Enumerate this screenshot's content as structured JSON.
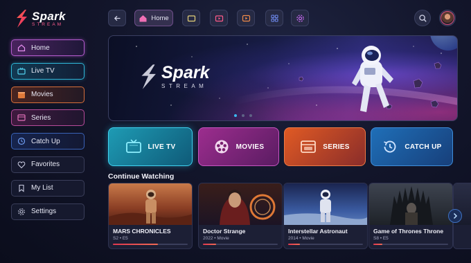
{
  "brand": {
    "name": "Spark",
    "sub": "STREAM"
  },
  "sidebar": {
    "items": [
      {
        "label": "Home",
        "icon": "home-icon",
        "color": "#c65cd9"
      },
      {
        "label": "Live TV",
        "icon": "tv-icon",
        "color": "#2fb8d9"
      },
      {
        "label": "Movies",
        "icon": "clapperboard-icon",
        "color": "#e07a3a"
      },
      {
        "label": "Series",
        "icon": "series-icon",
        "color": "#d3549f"
      },
      {
        "label": "Catch Up",
        "icon": "history-icon",
        "color": "#3f6fd0"
      },
      {
        "label": "Favorites",
        "icon": "heart-icon"
      },
      {
        "label": "My List",
        "icon": "bookmark-icon"
      },
      {
        "label": "Settings",
        "icon": "gear-icon"
      }
    ]
  },
  "topbar": {
    "home_label": "Home",
    "icons": [
      "back-arrow-icon",
      "home-icon",
      "tv-icon",
      "live-tv-icon",
      "play-icon",
      "grid-icon",
      "settings-icon",
      "search-icon",
      "avatar"
    ]
  },
  "hero": {
    "logo_big": "Spark",
    "logo_small": "STREAM",
    "slides": 3,
    "active_slide": 1
  },
  "categories": [
    {
      "label": "LIVE TV",
      "icon": "tv-icon"
    },
    {
      "label": "MOVIES",
      "icon": "film-reel-icon"
    },
    {
      "label": "SERIES",
      "icon": "series-icon"
    },
    {
      "label": "CATCH UP",
      "icon": "history-icon"
    }
  ],
  "continue_watching": {
    "title": "Continue Watching",
    "items": [
      {
        "title": "MARS CHRONICLES",
        "meta": "S2 • E5",
        "progress": 0.6
      },
      {
        "title": "Doctor Strange",
        "meta": "2022 • Movie",
        "progress": 0.18
      },
      {
        "title": "Interstellar Astronaut",
        "meta": "2014 • Movie",
        "progress": 0.16
      },
      {
        "title": "Game of Thrones Throne",
        "meta": "S8 • E5",
        "progress": 0.12
      }
    ]
  },
  "colors": {
    "accent": "#3bb8ef",
    "brand_pink": "#ff4f8b",
    "progress": "#e0384f"
  }
}
